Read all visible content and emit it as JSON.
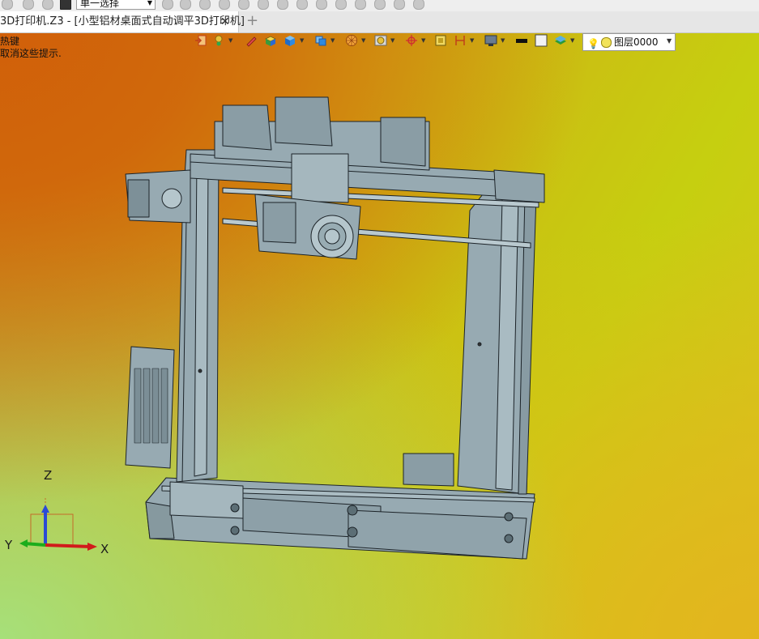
{
  "window": {
    "select_mode": "单一选择"
  },
  "tabs": [
    {
      "title": "3D打印机.Z3 - [小型铝材桌面式自动调平3D打印机]",
      "close": "✕"
    }
  ],
  "new_tab": "+",
  "hints": {
    "line1": "热键",
    "line2": "取消这些提示."
  },
  "view_toolbar": {
    "layer": "图层0000",
    "icons": [
      "exit-icon",
      "point-icon",
      "pen-icon",
      "shaded-box-icon",
      "solid-cube-icon",
      "view-cube-icon",
      "render-mode-icon",
      "display-filter-icon",
      "origin-icon",
      "frame-icon",
      "dimension-icon",
      "monitor-icon",
      "black-color-icon",
      "white-color-icon",
      "layer-stack-icon",
      "light-bulb-icon"
    ]
  },
  "colors": {
    "model_fill": "#97aab2",
    "model_stroke": "#1c2328",
    "axis_x": "#d11b1b",
    "axis_y": "#1cad1c",
    "axis_z": "#2a4ad6"
  },
  "triad": {
    "x": "X",
    "y": "Y",
    "z": "Z"
  }
}
